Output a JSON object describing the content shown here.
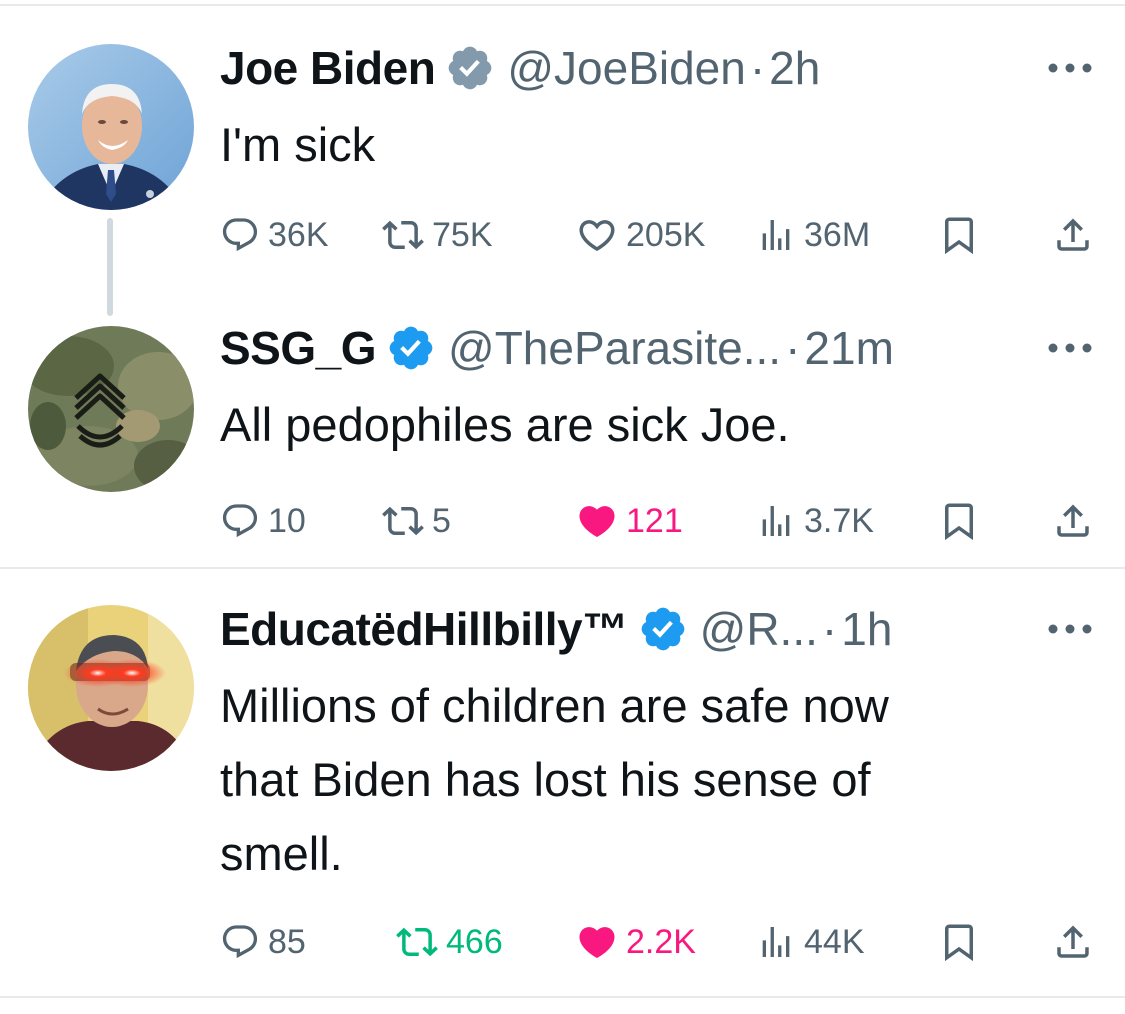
{
  "tweets": [
    {
      "name": "Joe Biden",
      "handle": "@JoeBiden",
      "separator": "·",
      "time": "2h",
      "verified": "gray",
      "text": "I'm sick",
      "replies": "36K",
      "retweets": "75K",
      "likes": "205K",
      "views": "36M",
      "liked": false,
      "retweeted": false
    },
    {
      "name": "SSG_G",
      "handle": "@TheParasite...",
      "separator": "·",
      "time": "21m",
      "verified": "blue",
      "text": "All pedophiles are sick Joe.",
      "replies": "10",
      "retweets": "5",
      "likes": "121",
      "views": "3.7K",
      "liked": true,
      "retweeted": false
    },
    {
      "name": "EducatëdHillbilly™",
      "handle": "@R...",
      "separator": "·",
      "time": "1h",
      "verified": "blue",
      "text_lines": [
        "Millions of children are safe now",
        "that Biden has lost his sense of",
        "smell."
      ],
      "replies": "85",
      "retweets": "466",
      "likes": "2.2K",
      "views": "44K",
      "liked": true,
      "retweeted": true
    }
  ],
  "colors": {
    "text": "#0f1419",
    "secondary": "#536471",
    "like": "#f91880",
    "retweet": "#00ba7c",
    "verified_blue": "#1d9bf0",
    "verified_gray": "#829aab",
    "divider": "#e7e9ea"
  },
  "icons": [
    "reply-icon",
    "retweet-icon",
    "like-icon",
    "views-icon",
    "bookmark-icon",
    "share-icon",
    "more-icon",
    "verified-badge-icon"
  ]
}
